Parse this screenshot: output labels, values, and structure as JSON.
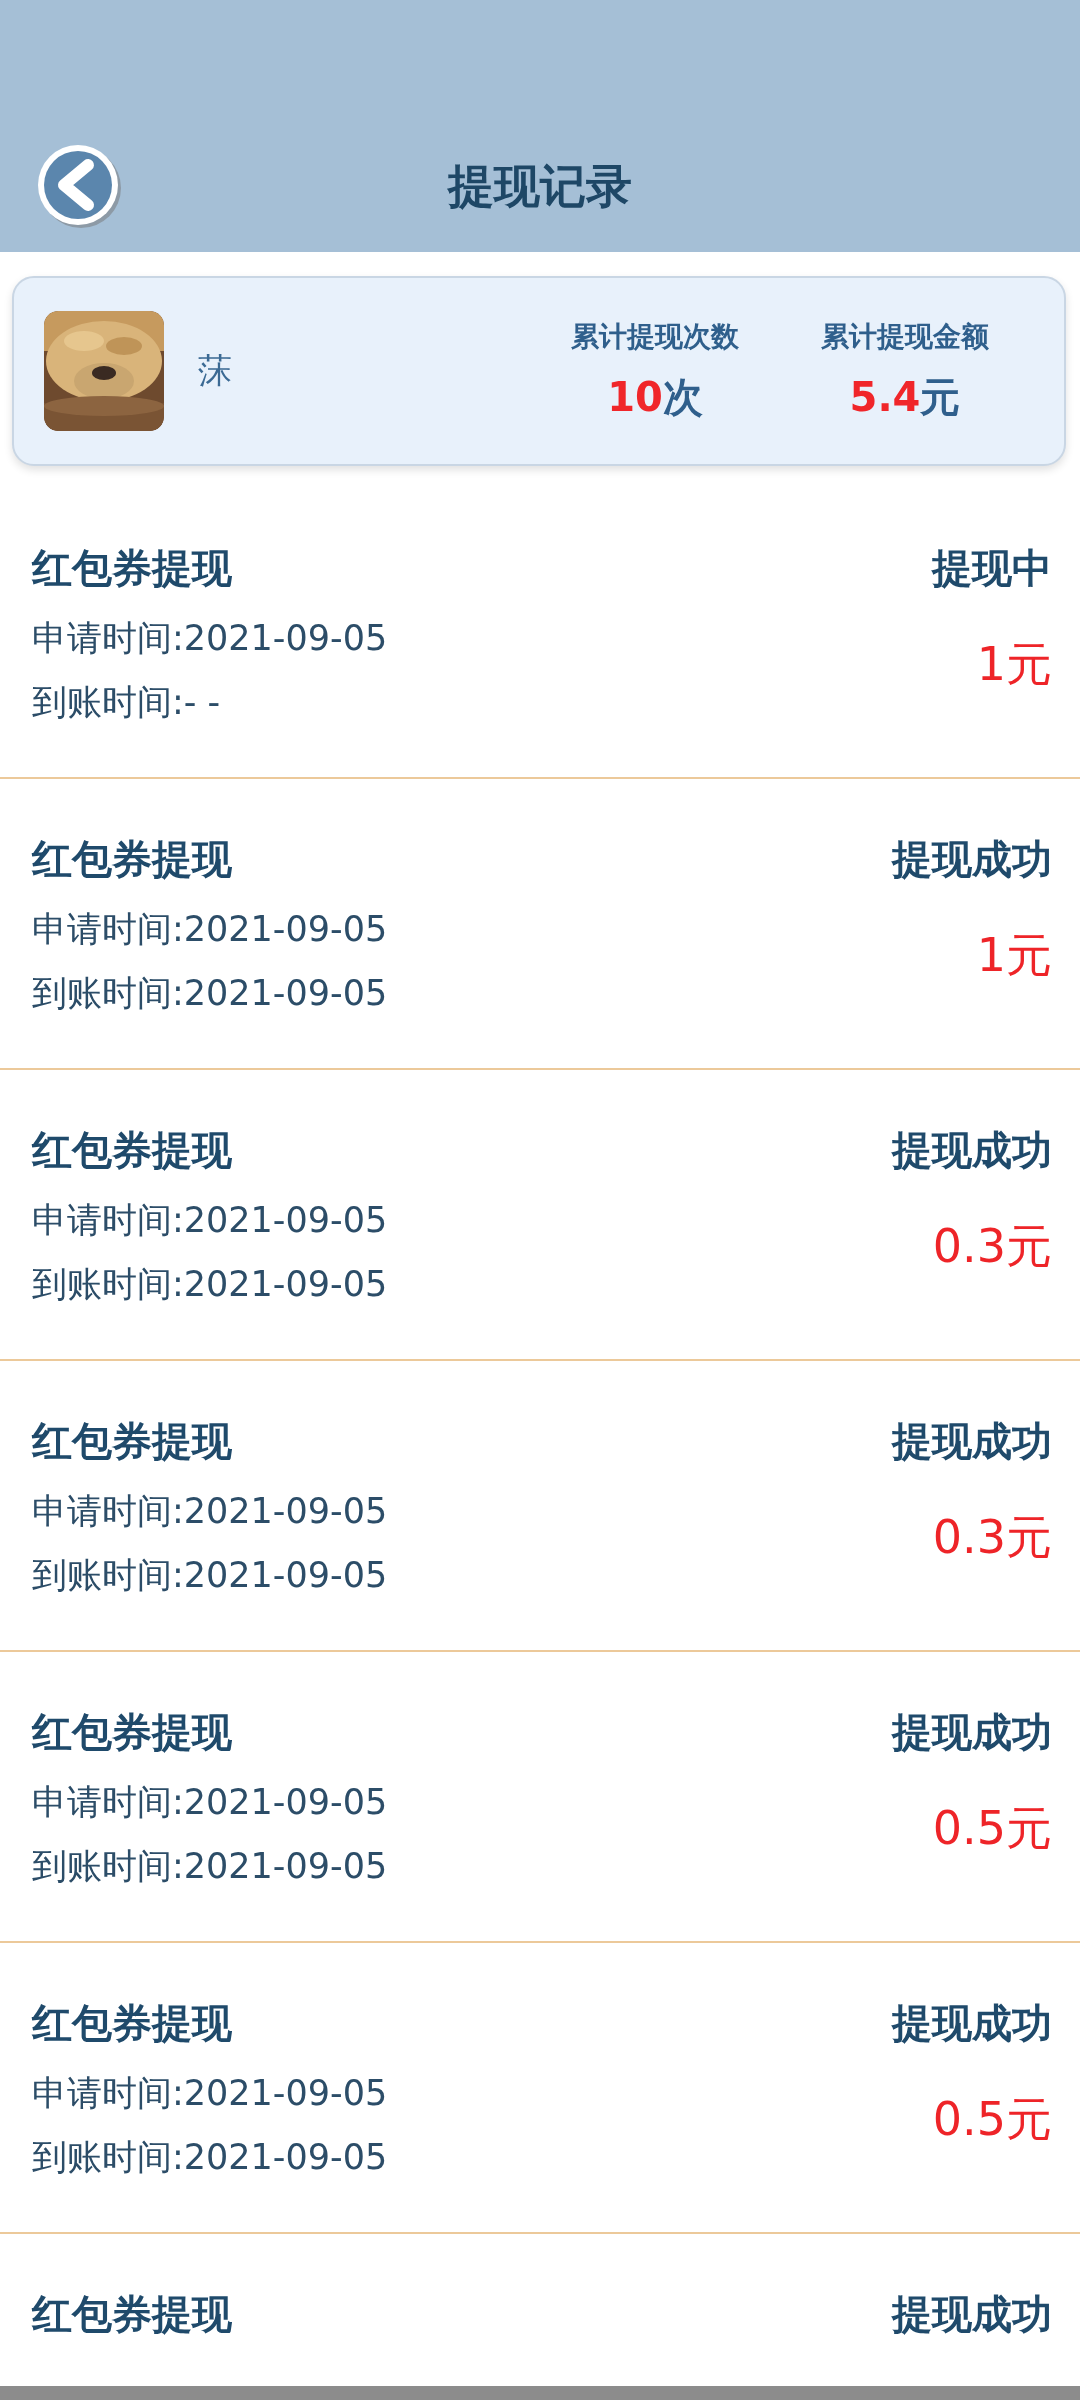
{
  "header": {
    "title": "提现记录"
  },
  "summary": {
    "name": "莯",
    "stats": [
      {
        "label": "累计提现次数",
        "number": "10",
        "unit": "次"
      },
      {
        "label": "累计提现金额",
        "number": "5.4",
        "unit": "元"
      }
    ]
  },
  "records": [
    {
      "title": "红包券提现",
      "status": "提现中",
      "apply_time": "申请时间:2021-09-05",
      "arrival_time": "到账时间:- -",
      "amount": "1元"
    },
    {
      "title": "红包券提现",
      "status": "提现成功",
      "apply_time": "申请时间:2021-09-05",
      "arrival_time": "到账时间:2021-09-05",
      "amount": "1元"
    },
    {
      "title": "红包券提现",
      "status": "提现成功",
      "apply_time": "申请时间:2021-09-05",
      "arrival_time": "到账时间:2021-09-05",
      "amount": "0.3元"
    },
    {
      "title": "红包券提现",
      "status": "提现成功",
      "apply_time": "申请时间:2021-09-05",
      "arrival_time": "到账时间:2021-09-05",
      "amount": "0.3元"
    },
    {
      "title": "红包券提现",
      "status": "提现成功",
      "apply_time": "申请时间:2021-09-05",
      "arrival_time": "到账时间:2021-09-05",
      "amount": "0.5元"
    },
    {
      "title": "红包券提现",
      "status": "提现成功",
      "apply_time": "申请时间:2021-09-05",
      "arrival_time": "到账时间:2021-09-05",
      "amount": "0.5元"
    },
    {
      "title": "红包券提现",
      "status": "提现成功"
    }
  ]
}
